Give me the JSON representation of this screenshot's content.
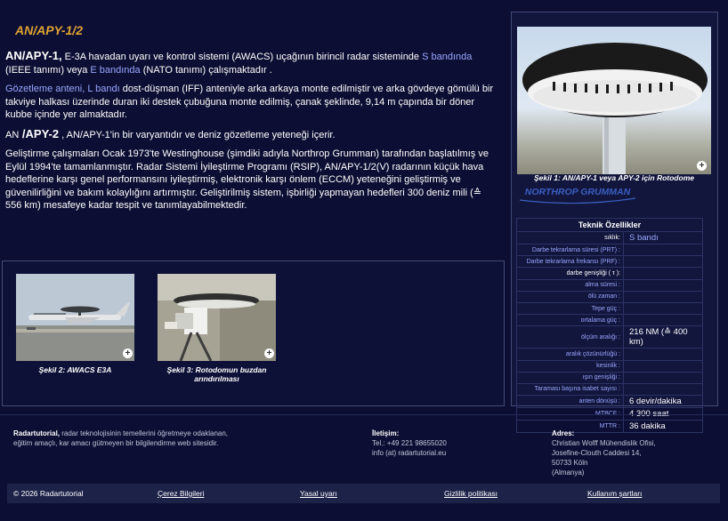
{
  "page_title": "AN/APY-1/2",
  "intro": {
    "p1_lead": "AN/APY-1,",
    "p1_text1": " E-3A havadan uyarı ve kontrol sistemi (AWACS) uçağının birincil radar sisteminde ",
    "p1_link1": "S bandında",
    "p1_text2": " (IEEE tanımı) veya ",
    "p1_link2": "E bandında",
    "p1_text3": " (NATO tanımı) çalışmaktadır .",
    "p2_link1": "Gözetleme anteni,",
    "p2_text1": " ",
    "p2_link2": "L bandı",
    "p2_text2": " dost-düşman (IFF) anteniyle arka arkaya monte edilmiştir ve arka gövdeye gömülü bir takviye halkası üzerinde duran iki destek çubuğuna monte edilmiş, çanak şeklinde, 9,14 m çapında bir döner kubbe içinde yer almaktadır.",
    "p3_lead_a": "AN",
    "p3_lead_b": " /APY-2",
    "p3_text": " , AN/APY-1'in bir varyantıdır ve deniz gözetleme yeteneği içerir.",
    "p4_text": "Geliştirme çalışmaları Ocak 1973'te Westinghouse (şimdiki adıyla Northrop Grumman) tarafından başlatılmış ve Eylül 1994'te tamamlanmıştır. Radar Sistemi İyileştirme Programı (RSIP), AN/APY-1/2(V) radarının küçük hava hedeflerine karşı genel performansını iyileştirmiş, elektronik karşı önlem (ECCM) yeteneğini geliştirmiş ve güvenilirliğini ve bakım kolaylığını artırmıştır. Geliştirilmiş sistem, işbirliği yapmayan hedefleri 300 deniz mili (≙ 556 km) mesafeye kadar tespit ve tanımlayabilmektedir."
  },
  "figure1_caption": "Şekil 1: AN/APY-1 veya APY-2 için Rotodome",
  "logo_text": "NORTHROP GRUMMAN",
  "spec_table": {
    "title": "Teknik Özellikler",
    "rows": [
      {
        "key": "sıklık:",
        "value": "S bandı"
      },
      {
        "key": "Darbe tekrarlama süresi (PRT) :",
        "value": ""
      },
      {
        "key": "Darbe tekrarlama frekansı (PRF) :",
        "value": ""
      },
      {
        "key": "darbe genişliği ( τ ):",
        "value": ""
      },
      {
        "key": "alma süresi :",
        "value": ""
      },
      {
        "key": "ölü zaman :",
        "value": ""
      },
      {
        "key": "Tepe güç :",
        "value": ""
      },
      {
        "key": "ortalama güç :",
        "value": ""
      },
      {
        "key": "ölçüm aralığı :",
        "value": "216 NM (≙ 400 km)"
      },
      {
        "key": "aralık çözünürlüğü :",
        "value": ""
      },
      {
        "key": "kesinlik :",
        "value": ""
      },
      {
        "key": "ışın genişliği :",
        "value": ""
      },
      {
        "key": "Taraması başına isabet sayısı :",
        "value": ""
      },
      {
        "key": "anten dönüşü :",
        "value": "6 devir/dakika"
      },
      {
        "key": "MTBCF :",
        "value": "4 300 saat"
      },
      {
        "key": "MTTR :",
        "value": "36 dakika"
      }
    ]
  },
  "gallery": {
    "fig2_caption": "Şekil 2: AWACS E3A",
    "fig3_caption_line1": "Şekil 3: Rotodomun buzdan",
    "fig3_caption_line2": "arındırılması"
  },
  "footer": {
    "about_name": "Radartutorial,",
    "about_text": " radar teknolojisinin temellerini öğretmeye odaklanan, eğitim amaçlı, kar amacı gütmeyen bir bilgilendirme web sitesidir.",
    "contact_title": "İletişim:",
    "contact_tel": "Tel.: +49 221 98655020",
    "contact_mail": "info (at) radartutorial.eu",
    "address_title": "Adres:",
    "address_line1": "Christian Wolff Mühendislik Ofisi,",
    "address_line2": "Josefine-Clouth Caddesi 14,",
    "address_line3": "50733 Köln",
    "address_line4": "(Almanya)"
  },
  "bottom_bar": {
    "copyright": "© 2026 Radartutorial",
    "cookies": "Çerez Bilgileri",
    "legal": "Yasal uyarı",
    "privacy": "Gizlilik politikası",
    "terms": "Kullanım şartları"
  },
  "colors": {
    "background": "#0c0f33",
    "title_accent": "#e0a233",
    "link_blue": "#9aa6ff"
  }
}
